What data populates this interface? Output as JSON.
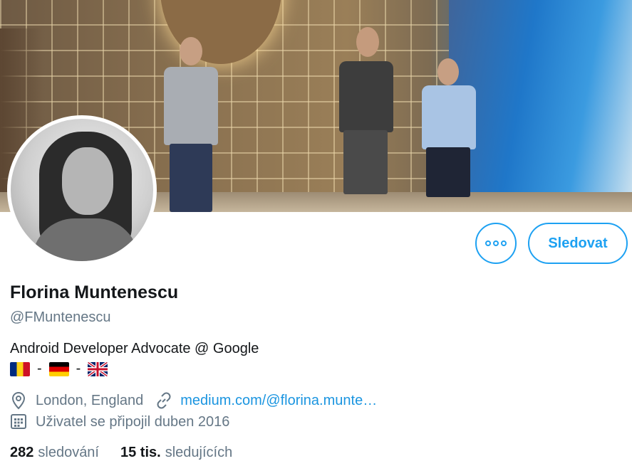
{
  "banner": {
    "image": "stage-photo-three-speakers"
  },
  "avatar": {
    "image": "profile-photo-woman"
  },
  "actions": {
    "more_icon": "more-horizontal-icon",
    "follow_label": "Sledovat"
  },
  "profile": {
    "name": "Florina Muntenescu",
    "handle": "@FMuntenescu",
    "bio": "Android Developer Advocate @ Google",
    "flags_separator_1": "-",
    "flags_separator_2": "-"
  },
  "meta": {
    "location_icon": "location-pin-icon",
    "location": "London, England",
    "link_icon": "link-icon",
    "link_text": "medium.com/@florina.munte…",
    "joined_icon": "calendar-icon",
    "joined": "Uživatel se připojil duben 2016"
  },
  "stats": {
    "following_count": "282",
    "following_label": "sledování",
    "followers_count": "15 tis.",
    "followers_label": "sledujících"
  },
  "colors": {
    "accent": "#1da1f2",
    "secondary_text": "#657786",
    "primary_text": "#14171a"
  }
}
